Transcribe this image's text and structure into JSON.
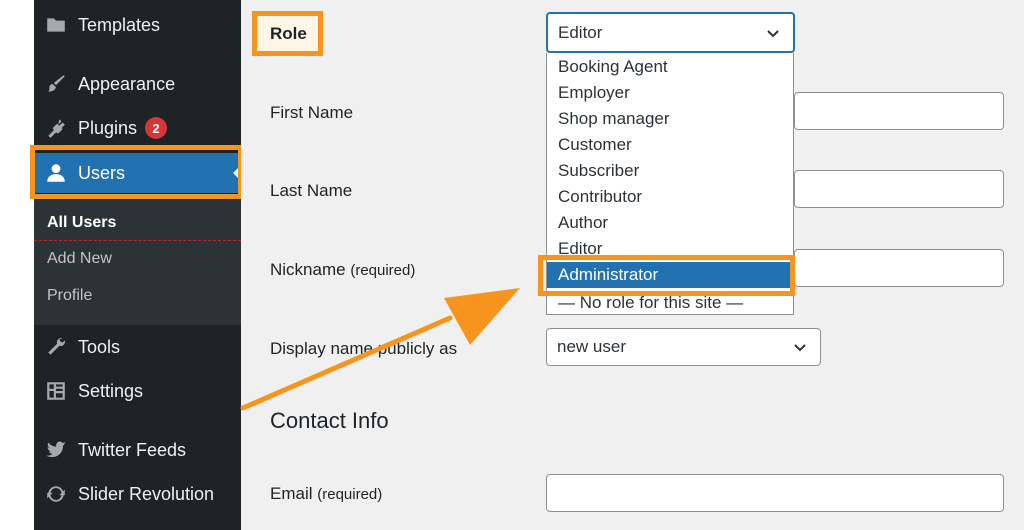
{
  "sidebar": {
    "items": [
      {
        "label": "Templates",
        "icon": "folder-icon"
      },
      {
        "label": "Appearance",
        "icon": "paintbrush-icon"
      },
      {
        "label": "Plugins",
        "icon": "plug-icon",
        "badge": "2"
      },
      {
        "label": "Users",
        "icon": "user-icon"
      },
      {
        "label": "Tools",
        "icon": "wrench-icon"
      },
      {
        "label": "Settings",
        "icon": "settings-icon"
      },
      {
        "label": "Twitter Feeds",
        "icon": "twitter-icon"
      },
      {
        "label": "Slider Revolution",
        "icon": "refresh-icon"
      }
    ],
    "submenu": [
      "All Users",
      "Add New",
      "Profile"
    ]
  },
  "form": {
    "role_label": "Role",
    "role_value": "Editor",
    "role_options": [
      "Booking Agent",
      "Employer",
      "Shop manager",
      "Customer",
      "Subscriber",
      "Contributor",
      "Author",
      "Editor",
      "Administrator",
      "— No role for this site —"
    ],
    "first_name_label": "First Name",
    "last_name_label": "Last Name",
    "nickname_label": "Nickname",
    "nickname_req": "(required)",
    "display_name_label": "Display name publicly as",
    "display_name_value": "new user",
    "contact_title": "Contact Info",
    "email_label": "Email",
    "email_req": "(required)"
  },
  "colors": {
    "highlight": "#f7941d",
    "accent": "#2271b1",
    "sidebar_bg": "#1d2327"
  }
}
